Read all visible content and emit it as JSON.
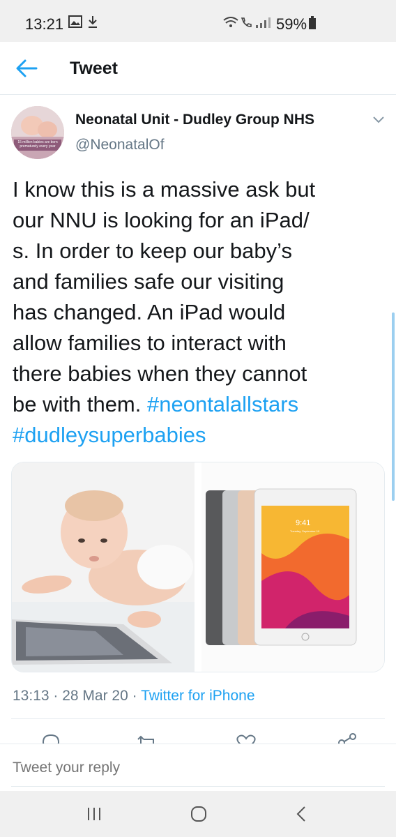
{
  "status_bar": {
    "time": "13:21",
    "battery": "59%",
    "icons": [
      "image-icon",
      "download-icon",
      "wifi-icon",
      "call-icon",
      "signal-icon",
      "battery-icon"
    ]
  },
  "header": {
    "title": "Tweet",
    "back_icon": "arrow-left-icon"
  },
  "tweet": {
    "author_name": "Neonatal Unit - Dudley Group NHS",
    "author_handle": "@NeonatalOf",
    "avatar_caption": "15 million babies are born prematurely every year",
    "text_lines": [
      "I know this is a massive ask but",
      "our NNU is looking for an iPad/",
      "s. In order to keep our baby’s",
      "and families safe our visiting",
      "has changed. An iPad would",
      "allow families to interact with",
      "there babies when they cannot"
    ],
    "text_tail": "be with them. ",
    "hashtags": [
      "#neontalallstars",
      "#dudleysuperbabies"
    ],
    "media": {
      "ipad_screen_time": "9:41",
      "ipad_screen_date": "Tuesday, September 10"
    },
    "time": "13:13",
    "date": "28 Mar 20",
    "separator": " · ",
    "source": "Twitter for iPhone"
  },
  "actions": [
    "reply-icon",
    "retweet-icon",
    "like-icon",
    "share-icon"
  ],
  "reply": {
    "placeholder": "Tweet your reply"
  },
  "nav": [
    "recent-apps-icon",
    "home-icon",
    "back-icon"
  ],
  "colors": {
    "accent": "#1da1f2",
    "secondary_text": "#657786",
    "primary_text": "#14171a"
  }
}
